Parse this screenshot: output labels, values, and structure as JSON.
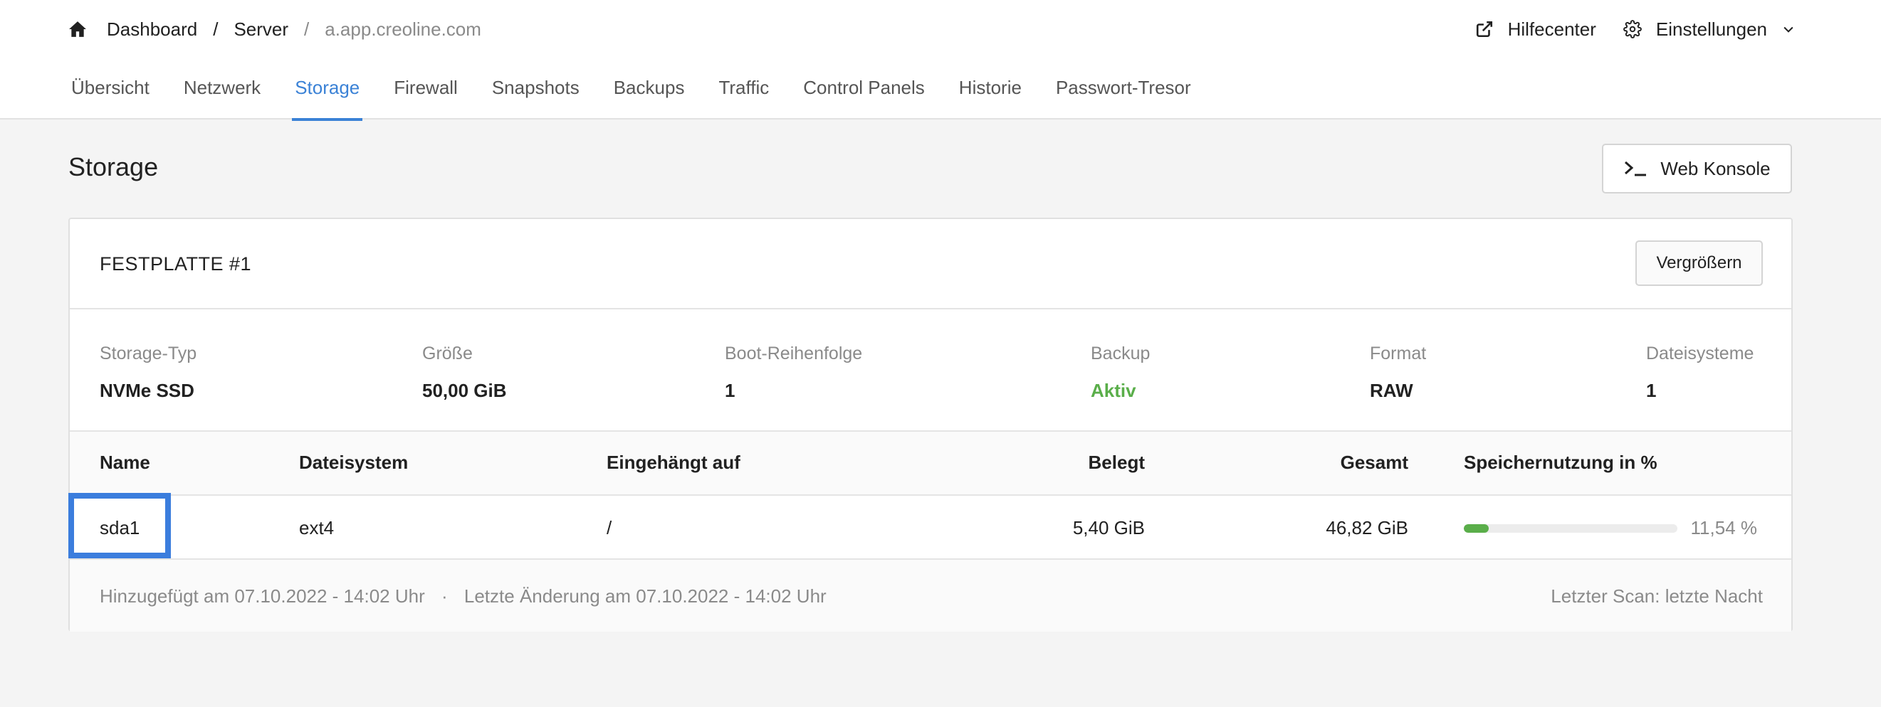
{
  "breadcrumb": {
    "home": "Dashboard",
    "server": "Server",
    "host": "a.app.creoline.com"
  },
  "top_right": {
    "help": "Hilfecenter",
    "settings": "Einstellungen"
  },
  "tabs": [
    {
      "label": "Übersicht",
      "active": false
    },
    {
      "label": "Netzwerk",
      "active": false
    },
    {
      "label": "Storage",
      "active": true
    },
    {
      "label": "Firewall",
      "active": false
    },
    {
      "label": "Snapshots",
      "active": false
    },
    {
      "label": "Backups",
      "active": false
    },
    {
      "label": "Traffic",
      "active": false
    },
    {
      "label": "Control Panels",
      "active": false
    },
    {
      "label": "Historie",
      "active": false
    },
    {
      "label": "Passwort-Tresor",
      "active": false
    }
  ],
  "page": {
    "title": "Storage",
    "console_button": "Web Konsole"
  },
  "disk": {
    "title": "FESTPLATTE #1",
    "resize_button": "Vergrößern",
    "props": [
      {
        "label": "Storage-Typ",
        "value": "NVMe SSD"
      },
      {
        "label": "Größe",
        "value": "50,00 GiB"
      },
      {
        "label": "Boot-Reihenfolge",
        "value": "1"
      },
      {
        "label": "Backup",
        "value": "Aktiv"
      },
      {
        "label": "Format",
        "value": "RAW"
      },
      {
        "label": "Dateisysteme",
        "value": "1"
      }
    ],
    "table": {
      "headers": [
        "Name",
        "Dateisystem",
        "Eingehängt auf",
        "Belegt",
        "Gesamt",
        "Speichernutzung in %"
      ],
      "rows": [
        {
          "name": "sda1",
          "fs": "ext4",
          "mount": "/",
          "used": "5,40 GiB",
          "total": "46,82 GiB",
          "usage_pct": 11.54,
          "usage_label": "11,54 %"
        }
      ]
    },
    "footer": {
      "added": "Hinzugefügt am 07.10.2022 - 14:02 Uhr",
      "separator": "·",
      "changed": "Letzte Änderung am 07.10.2022 - 14:02 Uhr",
      "scan": "Letzter Scan: letzte Nacht"
    }
  },
  "colors": {
    "accent": "#3b82d6",
    "success": "#5aae4a",
    "highlight": "#3b7ddd"
  }
}
